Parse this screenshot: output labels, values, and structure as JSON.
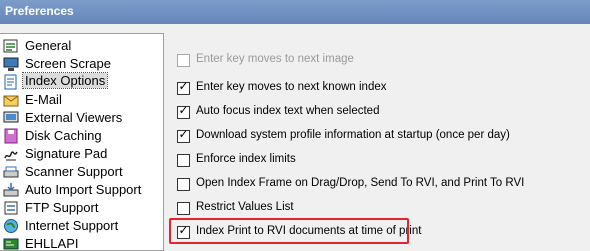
{
  "window": {
    "title": "Preferences"
  },
  "sidebar": {
    "items": [
      {
        "label": "General",
        "icon": "general-icon",
        "color": "#2f7d2f"
      },
      {
        "label": "Screen Scrape",
        "icon": "screen-scrape-icon",
        "color": "#2a2a2a"
      },
      {
        "label": "Index Options",
        "icon": "index-options-icon",
        "color": "#1c5fb0"
      },
      {
        "label": "E-Mail",
        "icon": "email-icon",
        "color": "#c89020"
      },
      {
        "label": "External Viewers",
        "icon": "external-viewers-icon",
        "color": "#303030"
      },
      {
        "label": "Disk Caching",
        "icon": "disk-caching-icon",
        "color": "#c040c0"
      },
      {
        "label": "Signature Pad",
        "icon": "signature-pad-icon",
        "color": "#3a3a3a"
      },
      {
        "label": "Scanner Support",
        "icon": "scanner-support-icon",
        "color": "#3a6fb0"
      },
      {
        "label": "Auto Import Support",
        "icon": "auto-import-icon",
        "color": "#3a6fb0"
      },
      {
        "label": "FTP Support",
        "icon": "ftp-support-icon",
        "color": "#3a6fb0"
      },
      {
        "label": "Internet Support",
        "icon": "internet-support-icon",
        "color": "#2a8a2a"
      },
      {
        "label": "EHLLAPI",
        "icon": "ehllapi-icon",
        "color": "#2a8a2a"
      }
    ],
    "selected": "Index Options"
  },
  "options": [
    {
      "label": "Enter key moves to next image",
      "checked": false,
      "disabled": true
    },
    {
      "label": "Enter key moves to next known index",
      "checked": true,
      "disabled": false
    },
    {
      "label": "Auto focus index text when selected",
      "checked": true,
      "disabled": false
    },
    {
      "label": "Download system profile information at startup (once per day)",
      "checked": true,
      "disabled": false
    },
    {
      "label": "Enforce index limits",
      "checked": false,
      "disabled": false
    },
    {
      "label": "Open Index Frame on Drag/Drop, Send To RVI, and Print To RVI",
      "checked": false,
      "disabled": false
    },
    {
      "label": "Restrict Values List",
      "checked": false,
      "disabled": false
    },
    {
      "label": "Index Print to RVI documents at time of print",
      "checked": true,
      "disabled": false
    }
  ],
  "colors": {
    "titlebar": "#6d8fc1",
    "highlight": "#e0262b"
  }
}
